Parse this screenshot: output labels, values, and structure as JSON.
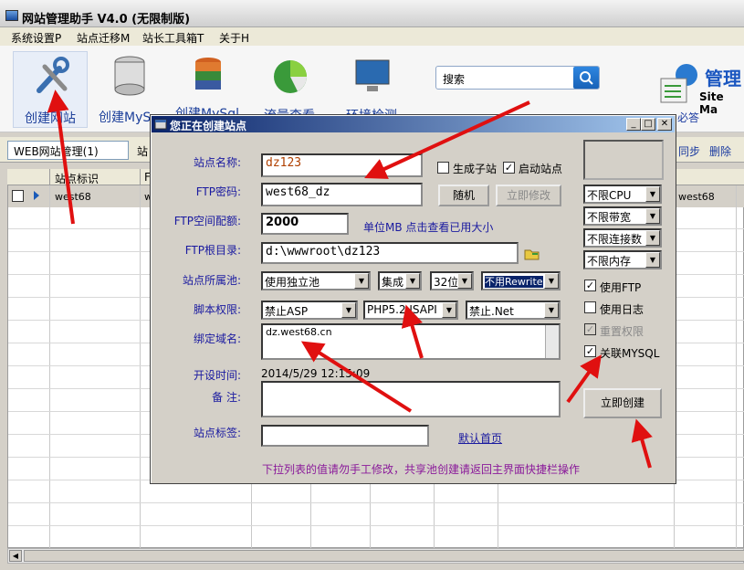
{
  "app": {
    "title": "网站管理助手 V4.0 (无限制版)"
  },
  "menu": [
    "系统设置P",
    "站点迁移M",
    "站长工具箱T",
    "关于H"
  ],
  "toolbar": {
    "items": [
      "创建网站",
      "创建MySql",
      "创建MySql",
      "流量查看",
      "环境检测"
    ],
    "search_text": "搜索",
    "brand_title": "管理",
    "brand_sub": "Site Ma",
    "banner_text": "必答"
  },
  "tab": {
    "label": "WEB网站管理(1)",
    "next": "站"
  },
  "grid": {
    "headers": [
      "站点标识",
      "F"
    ],
    "row": {
      "site": "west68",
      "col2": "w"
    },
    "right_actions": [
      "同步",
      "删除"
    ],
    "right_cell": "west68"
  },
  "dialog": {
    "title": "您正在创建站点",
    "labels": {
      "site_name": "站点名称:",
      "ftp_password": "FTP密码:",
      "ftp_quota": "FTP空间配额:",
      "ftp_root": "FTP根目录:",
      "pool": "站点所属池:",
      "script_perm": "脚本权限:",
      "domain": "绑定域名:",
      "created": "开设时间:",
      "remark": "备  注:",
      "tag": "站点标签:"
    },
    "values": {
      "site_name": "dz123",
      "ftp_password": "west68_dz",
      "ftp_quota": "2000",
      "quota_hint": "单位MB 点击查看已用大小",
      "ftp_root": "d:\\wwwroot\\dz123",
      "domain": "dz.west68.cn",
      "created": "2014/5/29 12:15:09",
      "remark": "",
      "tag": ""
    },
    "combos": {
      "pool": "使用独立池",
      "pool_mode": "集成",
      "bits": "32位",
      "rewrite": "不用Rewrite",
      "asp": "禁止ASP",
      "php": "PHP5.2 ISAPI",
      "net": "禁止.Net",
      "cpu": "不限CPU",
      "bandwidth": "不限带宽",
      "connections": "不限连接数",
      "memory": "不限内存"
    },
    "checks": {
      "sub_site": {
        "label": "生成子站",
        "checked": false
      },
      "start_site": {
        "label": "启动站点",
        "checked": true
      },
      "use_ftp": {
        "label": "使用FTP",
        "checked": true
      },
      "use_log": {
        "label": "使用日志",
        "checked": false
      },
      "reset_perm": {
        "label": "重置权限",
        "checked": true
      },
      "link_mysql": {
        "label": "关联MYSQL",
        "checked": true
      }
    },
    "buttons": {
      "random": "随机",
      "modify": "立即修改",
      "create": "立即创建",
      "default_page": "默认首页"
    },
    "footer_note": "下拉列表的值请勿手工修改，共享池创建请返回主界面快捷栏操作"
  }
}
